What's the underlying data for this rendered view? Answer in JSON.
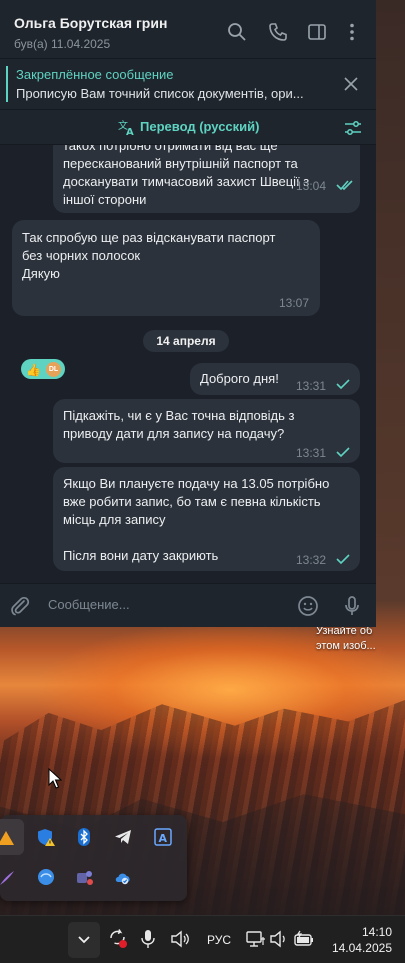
{
  "chat": {
    "name": "Ольга Борутская грин",
    "status": "був(а) 11.04.2025"
  },
  "pinned": {
    "title": "Закреплённое сообщение",
    "text": "Прописую Вам точний список документів, ори..."
  },
  "translate": {
    "label": "Перевод (русский)"
  },
  "messages": [
    {
      "id": "m1",
      "dir": "out",
      "text": "такох потрібно отримати від вас ще\nпересканований внутрішній паспорт та\nдосканувати тимчасовий захист Швеції з\nіншої сторони",
      "time": "13:04",
      "status": "read"
    },
    {
      "id": "m2",
      "dir": "in",
      "text": "Так спробую ще раз відсканувати паспорт\nбез чорних полосок\nДякую",
      "time": "13:07",
      "reaction": "👍",
      "reaction_avatar": "DL"
    },
    {
      "id": "m3",
      "dir": "out",
      "text": "Доброго дня!",
      "time": "13:31",
      "status": "sent"
    },
    {
      "id": "m4",
      "dir": "out",
      "text": "Підкажіть, чи є у Вас точна відповідь з\nприводу дати для запису на подачу?",
      "time": "13:31",
      "status": "sent"
    },
    {
      "id": "m5",
      "dir": "out",
      "text": "Якщо Ви плануєте подачу на 13.05 потрібно\nвже робити запис, бо там є певна кількість\nмісць для запису\n\nПісля вони дату закриють",
      "time": "13:32",
      "status": "sent"
    }
  ],
  "date_separator": "14 апреля",
  "composer": {
    "placeholder": "Сообщение..."
  },
  "desktop": {
    "caption_line1": "Узнайте об",
    "caption_line2": "этом изоб..."
  },
  "taskbar": {
    "language": "РУС",
    "time": "14:10",
    "date": "14.04.2025"
  },
  "colors": {
    "accent": "#5ed3c2",
    "window_bg": "#1b2029",
    "bubble_bg": "#2c323b"
  }
}
